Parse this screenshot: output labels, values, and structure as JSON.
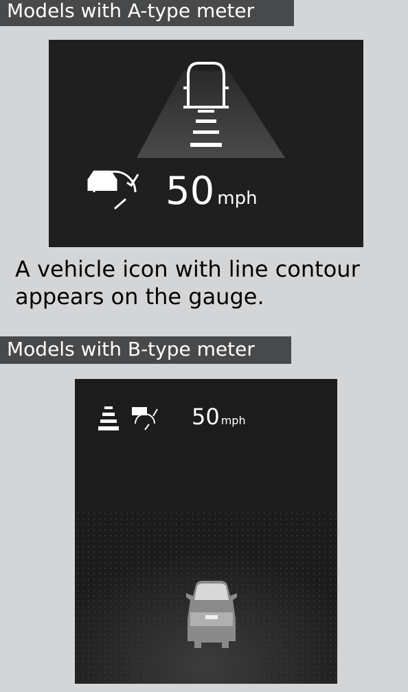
{
  "section_a": {
    "label": "Models with A-type meter",
    "speed_value": "50",
    "speed_unit": "mph",
    "icons": [
      "lead-vehicle-outline-icon",
      "distance-bars-icon",
      "cruise-control-speedometer-icon"
    ]
  },
  "caption": "A vehicle icon with line contour appears on the gauge.",
  "section_b": {
    "label": "Models with B-type meter",
    "speed_value": "50",
    "speed_unit": "mph",
    "icons": [
      "distance-bars-icon",
      "cruise-control-speedometer-icon",
      "lead-vehicle-icon"
    ]
  },
  "colors": {
    "page_background": "#d4d5d7",
    "label_background": "#48494b",
    "screen_background": "#1f1f1f"
  }
}
